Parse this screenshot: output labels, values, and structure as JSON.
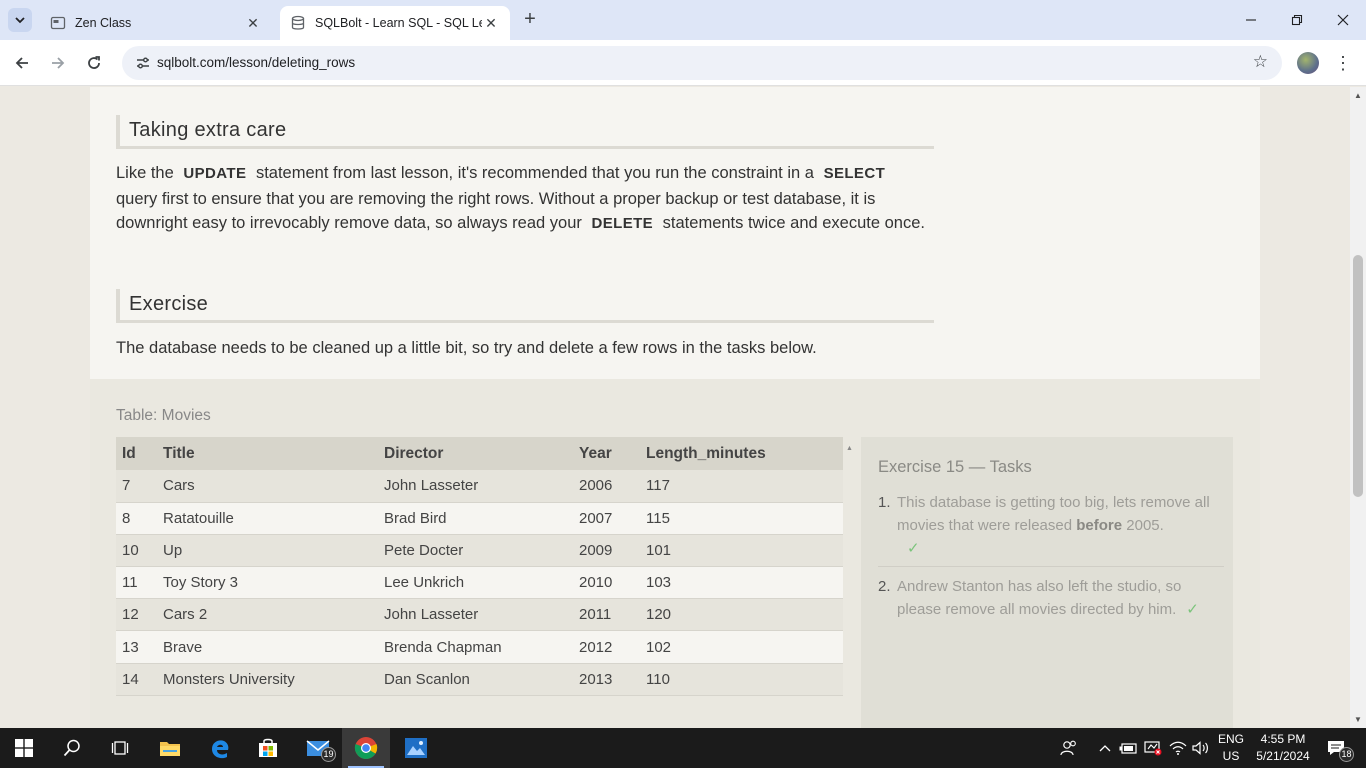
{
  "browser": {
    "tabs": [
      {
        "title": "Zen Class",
        "favicon": "zen-class-favicon"
      },
      {
        "title": "SQLBolt - Learn SQL - SQL Less",
        "favicon": "sqlbolt-favicon"
      }
    ],
    "url": "sqlbolt.com/lesson/deleting_rows"
  },
  "lesson": {
    "section1": {
      "heading": "Taking extra care",
      "p_1": "Like the",
      "kw_update": "UPDATE",
      "p_2": "statement from last lesson, it's recommended that you run the constraint in a",
      "kw_select": "SELECT",
      "p_3": "query first to ensure that you are removing the right rows. Without a proper backup or test database, it is downright easy to irrevocably remove data, so always read your",
      "kw_delete": "DELETE",
      "p_4": "statements twice and execute once."
    },
    "section2": {
      "heading": "Exercise",
      "text": "The database needs to be cleaned up a little bit, so try and delete a few rows in the tasks below."
    }
  },
  "table": {
    "caption": "Table: Movies",
    "columns": [
      "Id",
      "Title",
      "Director",
      "Year",
      "Length_minutes"
    ],
    "rows": [
      [
        "7",
        "Cars",
        "John Lasseter",
        "2006",
        "117"
      ],
      [
        "8",
        "Ratatouille",
        "Brad Bird",
        "2007",
        "115"
      ],
      [
        "10",
        "Up",
        "Pete Docter",
        "2009",
        "101"
      ],
      [
        "11",
        "Toy Story 3",
        "Lee Unkrich",
        "2010",
        "103"
      ],
      [
        "12",
        "Cars 2",
        "John Lasseter",
        "2011",
        "120"
      ],
      [
        "13",
        "Brave",
        "Brenda Chapman",
        "2012",
        "102"
      ],
      [
        "14",
        "Monsters University",
        "Dan Scanlon",
        "2013",
        "110"
      ]
    ]
  },
  "tasks": {
    "title": "Exercise 15 — Tasks",
    "items": [
      {
        "num": "1.",
        "pre": "This database is getting too big, lets remove all movies that were released",
        "bold": "before",
        "post": "2005.",
        "check": "✓"
      },
      {
        "num": "2.",
        "text": "Andrew Stanton has also left the studio, so please remove all movies directed by him.",
        "check": "✓"
      }
    ]
  },
  "taskbar": {
    "mail_badge": "19",
    "lang_1": "ENG",
    "lang_2": "US",
    "time": "4:55 PM",
    "date": "5/21/2024",
    "notif_badge": "18"
  }
}
